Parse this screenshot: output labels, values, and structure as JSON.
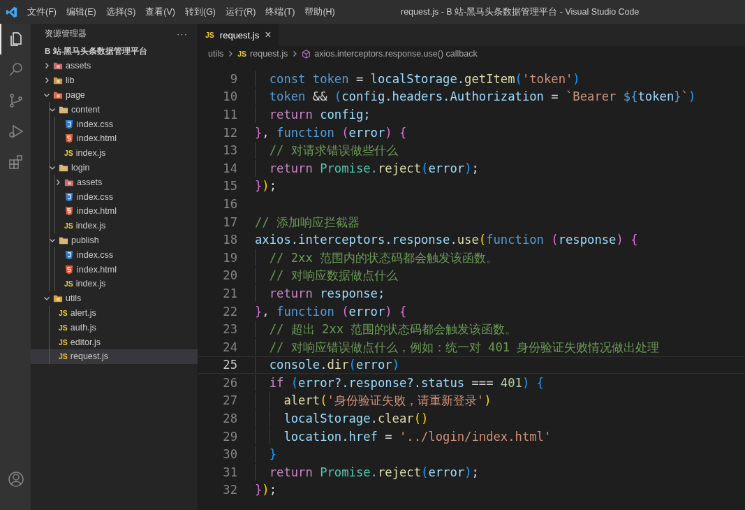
{
  "title_bar": {
    "menu": [
      "文件(F)",
      "编辑(E)",
      "选择(S)",
      "查看(V)",
      "转到(G)",
      "运行(R)",
      "终端(T)",
      "帮助(H)"
    ],
    "title": "request.js - B 站-黑马头条数据管理平台 - Visual Studio Code"
  },
  "activity_bar": [
    {
      "kind": "explorer",
      "selected": true
    },
    {
      "kind": "search",
      "selected": false
    },
    {
      "kind": "source-control",
      "selected": false
    },
    {
      "kind": "run",
      "selected": false
    },
    {
      "kind": "extensions",
      "selected": false
    },
    {
      "kind": "account",
      "selected": false
    }
  ],
  "explorer": {
    "title": "资源管理器",
    "more": "···",
    "project": "B 站-黑马头条数据管理平台",
    "tree": [
      {
        "kind": "assets",
        "label": "assets",
        "expanded": false,
        "selected": false
      },
      {
        "kind": "lib",
        "label": "lib",
        "expanded": false,
        "selected": false
      },
      {
        "kind": "page",
        "label": "page",
        "expanded": true,
        "selected": false,
        "children": [
          {
            "kind": "folder",
            "label": "content",
            "expanded": true,
            "selected": false,
            "children": [
              {
                "kind": "css",
                "label": "index.css",
                "selected": false
              },
              {
                "kind": "html",
                "label": "index.html",
                "selected": false
              },
              {
                "kind": "js",
                "icon_label": "JS",
                "label": "index.js",
                "selected": false
              }
            ]
          },
          {
            "kind": "folder",
            "label": "login",
            "expanded": true,
            "selected": false,
            "children": [
              {
                "kind": "assets",
                "label": "assets",
                "expanded": false,
                "selected": false
              },
              {
                "kind": "css",
                "label": "index.css",
                "selected": false
              },
              {
                "kind": "html",
                "label": "index.html",
                "selected": false
              },
              {
                "kind": "js",
                "icon_label": "JS",
                "label": "index.js",
                "selected": false
              }
            ]
          },
          {
            "kind": "folder",
            "label": "publish",
            "expanded": true,
            "selected": false,
            "children": [
              {
                "kind": "css",
                "label": "index.css",
                "selected": false
              },
              {
                "kind": "html",
                "label": "index.html",
                "selected": false
              },
              {
                "kind": "js",
                "icon_label": "JS",
                "label": "index.js",
                "selected": false
              }
            ]
          }
        ]
      },
      {
        "kind": "utils",
        "label": "utils",
        "expanded": true,
        "selected": false,
        "children": [
          {
            "kind": "js",
            "icon_label": "JS",
            "label": "alert.js",
            "selected": false
          },
          {
            "kind": "js",
            "icon_label": "JS",
            "label": "auth.js",
            "selected": false
          },
          {
            "kind": "js",
            "icon_label": "JS",
            "label": "editor.js",
            "selected": false
          },
          {
            "kind": "js",
            "icon_label": "JS",
            "label": "request.js",
            "selected": true
          }
        ]
      }
    ]
  },
  "tabs": [
    {
      "icon_label": "JS",
      "label": "request.js",
      "close": "×",
      "selected": true
    }
  ],
  "breadcrumb": [
    {
      "kind": "folder",
      "label": "utils"
    },
    {
      "kind": "file",
      "icon_label": "JS",
      "label": "request.js"
    },
    {
      "kind": "symbol",
      "label": "axios.interceptors.response.use() callback"
    }
  ],
  "editor": {
    "lines": [
      {
        "number": "9",
        "current": false,
        "tokens": [
          {
            "kind": "kw",
            "t": "  const"
          },
          {
            "kind": "kw",
            "t": " token"
          },
          {
            "kind": "p",
            "t": " ="
          },
          {
            "kind": "var",
            "t": " localStorage."
          },
          {
            "kind": "fn",
            "t": "getItem"
          },
          {
            "kind": "b3",
            "t": "("
          },
          {
            "kind": "str",
            "t": "'token'"
          },
          {
            "kind": "b3",
            "t": ")"
          }
        ]
      },
      {
        "number": "10",
        "current": false,
        "tokens": [
          {
            "kind": "kw",
            "t": "  token"
          },
          {
            "kind": "p",
            "t": " &&"
          },
          {
            "kind": "b3",
            "t": " ("
          },
          {
            "kind": "var",
            "t": "config.headers.Authorization"
          },
          {
            "kind": "p",
            "t": " ="
          },
          {
            "kind": "str",
            "t": " `Bearer"
          },
          {
            "kind": "kw",
            "t": " ${"
          },
          {
            "kind": "var",
            "t": "token"
          },
          {
            "kind": "kw",
            "t": "}"
          },
          {
            "kind": "str",
            "t": "`"
          },
          {
            "kind": "b3",
            "t": ")"
          }
        ]
      },
      {
        "number": "11",
        "current": false,
        "tokens": [
          {
            "kind": "ctl",
            "t": "  return"
          },
          {
            "kind": "var",
            "t": " config;"
          }
        ]
      },
      {
        "number": "12",
        "current": false,
        "tokens": [
          {
            "kind": "b2",
            "t": "}"
          },
          {
            "kind": "p",
            "t": ","
          },
          {
            "kind": "kw",
            "t": " function"
          },
          {
            "kind": "b2",
            "t": " ("
          },
          {
            "kind": "var",
            "t": "error"
          },
          {
            "kind": "b2",
            "t": ") {"
          }
        ]
      },
      {
        "number": "13",
        "current": false,
        "tokens": [
          {
            "kind": "cm",
            "t": "  // 对请求错误做些什么"
          }
        ]
      },
      {
        "number": "14",
        "current": false,
        "tokens": [
          {
            "kind": "ctl",
            "t": "  return"
          },
          {
            "kind": "cls",
            "t": " Promise."
          },
          {
            "kind": "fn",
            "t": "reject"
          },
          {
            "kind": "b3",
            "t": "("
          },
          {
            "kind": "var",
            "t": "error"
          },
          {
            "kind": "b3",
            "t": ")"
          },
          {
            "kind": "p",
            "t": ";"
          }
        ]
      },
      {
        "number": "15",
        "current": false,
        "tokens": [
          {
            "kind": "b2",
            "t": "}"
          },
          {
            "kind": "b1",
            "t": ")"
          },
          {
            "kind": "p",
            "t": ";"
          }
        ]
      },
      {
        "number": "16",
        "current": false
      },
      {
        "number": "17",
        "current": false,
        "tokens": [
          {
            "kind": "cm",
            "t": "// 添加响应拦截器"
          }
        ]
      },
      {
        "number": "18",
        "current": false,
        "tokens": [
          {
            "kind": "var",
            "t": "axios.interceptors.response."
          },
          {
            "kind": "fn",
            "t": "use"
          },
          {
            "kind": "b1",
            "t": "("
          },
          {
            "kind": "kw",
            "t": "function"
          },
          {
            "kind": "b2",
            "t": " ("
          },
          {
            "kind": "var",
            "t": "response"
          },
          {
            "kind": "b2",
            "t": ") {"
          }
        ]
      },
      {
        "number": "19",
        "current": false,
        "tokens": [
          {
            "kind": "cm",
            "t": "  // 2xx 范围内的状态码都会触发该函数。"
          }
        ]
      },
      {
        "number": "20",
        "current": false,
        "tokens": [
          {
            "kind": "cm",
            "t": "  // 对响应数据做点什么"
          }
        ]
      },
      {
        "number": "21",
        "current": false,
        "tokens": [
          {
            "kind": "ctl",
            "t": "  return"
          },
          {
            "kind": "var",
            "t": " response;"
          }
        ]
      },
      {
        "number": "22",
        "current": false,
        "tokens": [
          {
            "kind": "b2",
            "t": "}"
          },
          {
            "kind": "p",
            "t": ","
          },
          {
            "kind": "kw",
            "t": " function"
          },
          {
            "kind": "b2",
            "t": " ("
          },
          {
            "kind": "var",
            "t": "error"
          },
          {
            "kind": "b2",
            "t": ") {"
          }
        ]
      },
      {
        "number": "23",
        "current": false,
        "tokens": [
          {
            "kind": "cm",
            "t": "  // 超出 2xx 范围的状态码都会触发该函数。"
          }
        ]
      },
      {
        "number": "24",
        "current": false,
        "tokens": [
          {
            "kind": "cm",
            "t": "  // 对响应错误做点什么，例如：统一对 401 身份验证失败情况做出处理"
          }
        ]
      },
      {
        "number": "25",
        "current": true,
        "tokens": [
          {
            "kind": "var",
            "t": "  console."
          },
          {
            "kind": "fn",
            "t": "dir"
          },
          {
            "kind": "b3",
            "t": "("
          },
          {
            "kind": "var",
            "t": "error"
          },
          {
            "kind": "b3",
            "t": ")"
          }
        ]
      },
      {
        "number": "26",
        "current": false,
        "tokens": [
          {
            "kind": "ctl",
            "t": "  if"
          },
          {
            "kind": "b3",
            "t": " ("
          },
          {
            "kind": "var",
            "t": "error?.response?.status"
          },
          {
            "kind": "p",
            "t": " ==="
          },
          {
            "kind": "num",
            "t": " 401"
          },
          {
            "kind": "b3",
            "t": ") {"
          }
        ]
      },
      {
        "number": "27",
        "current": false,
        "tokens": [
          {
            "kind": "fn",
            "t": "    alert"
          },
          {
            "kind": "b1",
            "t": "("
          },
          {
            "kind": "str",
            "t": "'身份验证失败，请重新登录'"
          },
          {
            "kind": "b1",
            "t": ")"
          }
        ]
      },
      {
        "number": "28",
        "current": false,
        "tokens": [
          {
            "kind": "var",
            "t": "    localStorage."
          },
          {
            "kind": "fn",
            "t": "clear"
          },
          {
            "kind": "b1",
            "t": "()"
          }
        ]
      },
      {
        "number": "29",
        "current": false,
        "tokens": [
          {
            "kind": "var",
            "t": "    location.href"
          },
          {
            "kind": "p",
            "t": " ="
          },
          {
            "kind": "str",
            "t": " '../login/index.html'"
          }
        ]
      },
      {
        "number": "30",
        "current": false,
        "tokens": [
          {
            "kind": "b3",
            "t": "  }"
          }
        ]
      },
      {
        "number": "31",
        "current": false,
        "tokens": [
          {
            "kind": "ctl",
            "t": "  return"
          },
          {
            "kind": "cls",
            "t": " Promise."
          },
          {
            "kind": "fn",
            "t": "reject"
          },
          {
            "kind": "b3",
            "t": "("
          },
          {
            "kind": "var",
            "t": "error"
          },
          {
            "kind": "b3",
            "t": ")"
          },
          {
            "kind": "p",
            "t": ";"
          }
        ]
      },
      {
        "number": "32",
        "current": false,
        "tokens": [
          {
            "kind": "b2",
            "t": "}"
          },
          {
            "kind": "b1",
            "t": ")"
          },
          {
            "kind": "p",
            "t": ";"
          }
        ]
      }
    ]
  }
}
